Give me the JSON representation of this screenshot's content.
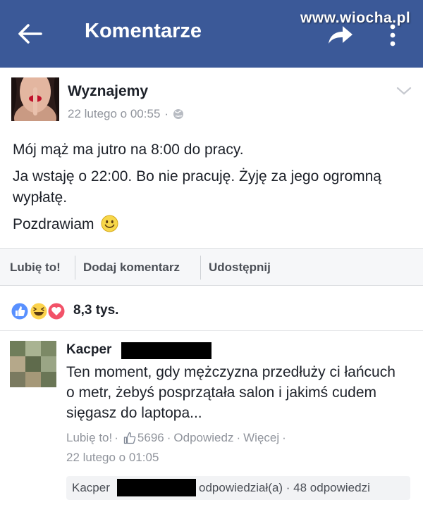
{
  "topbar": {
    "title": "Komentarze",
    "watermark": "www.wiocha.pl",
    "icons": [
      "back-arrow-icon",
      "share-icon",
      "more-vertical-icon"
    ],
    "background": "#3b5998"
  },
  "post": {
    "author": "Wyznajemy",
    "timestamp": "22 lutego o 00:55",
    "separator": "·",
    "privacy_icon": "globe-icon",
    "lines": [
      "Mój mąż ma jutro na 8:00 do pracy.",
      "Ja wstaję o 22:00. Bo nie pracuję. Żyję za jego ogromną wypłatę.",
      "Pozdrawiam"
    ],
    "emoji": "smiley-icon"
  },
  "actions": {
    "like": "Lubię to!",
    "comment": "Dodaj komentarz",
    "share": "Udostępnij"
  },
  "reactions": {
    "icons": [
      "like-reaction-icon",
      "haha-reaction-icon",
      "love-reaction-icon"
    ],
    "count": "8,3 tys."
  },
  "comment": {
    "author": "Kacper",
    "text": "Ten moment, gdy mężczyzna przedłuży ci łańcuch o metr, żebyś posprzątała salon i jakimś cudem sięgasz do laptopa...",
    "like": "Lubię to!",
    "sep": "·",
    "like_count": "5696",
    "reply": "Odpowiedz",
    "more": "Więcej",
    "timestamp": "22 lutego o 01:05",
    "reply_author": "Kacper",
    "reply_summary": "odpowiedział(a) · 48 odpowiedzi"
  },
  "colors": {
    "brand": "#3b5998",
    "meta_text": "#90949c",
    "like_blue": "#5890ff",
    "love_red": "#f25268",
    "haha_yellow": "#fcd34d"
  }
}
